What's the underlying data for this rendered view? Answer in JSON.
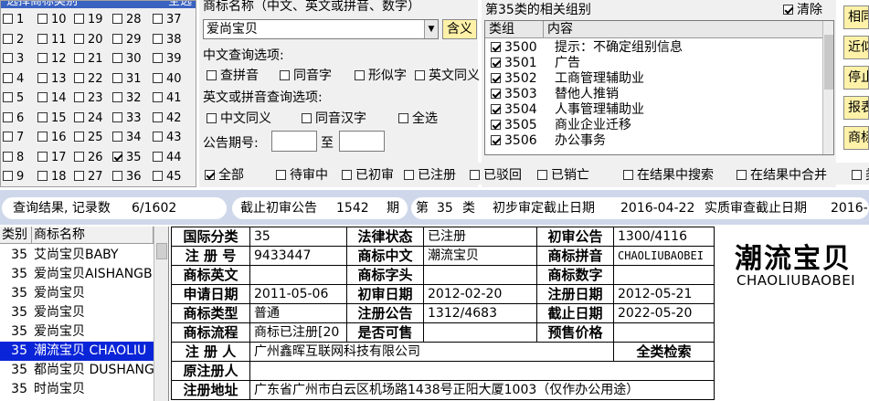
{
  "class_grid": {
    "title": "选择商标类别",
    "title_right": "全选",
    "columns": [
      [
        {
          "n": "1",
          "c": false
        },
        {
          "n": "2",
          "c": false
        },
        {
          "n": "3",
          "c": false
        },
        {
          "n": "4",
          "c": false
        },
        {
          "n": "5",
          "c": false
        },
        {
          "n": "6",
          "c": false
        },
        {
          "n": "7",
          "c": false
        },
        {
          "n": "8",
          "c": false
        },
        {
          "n": "9",
          "c": false
        }
      ],
      [
        {
          "n": "10",
          "c": false
        },
        {
          "n": "11",
          "c": false
        },
        {
          "n": "12",
          "c": false
        },
        {
          "n": "13",
          "c": false
        },
        {
          "n": "14",
          "c": false
        },
        {
          "n": "15",
          "c": false
        },
        {
          "n": "16",
          "c": false
        },
        {
          "n": "17",
          "c": false
        },
        {
          "n": "18",
          "c": false
        }
      ],
      [
        {
          "n": "19",
          "c": false
        },
        {
          "n": "20",
          "c": false
        },
        {
          "n": "21",
          "c": false
        },
        {
          "n": "22",
          "c": false
        },
        {
          "n": "23",
          "c": false
        },
        {
          "n": "24",
          "c": false
        },
        {
          "n": "25",
          "c": false
        },
        {
          "n": "26",
          "c": false
        },
        {
          "n": "27",
          "c": false
        }
      ],
      [
        {
          "n": "28",
          "c": false
        },
        {
          "n": "29",
          "c": false
        },
        {
          "n": "30",
          "c": false
        },
        {
          "n": "31",
          "c": false
        },
        {
          "n": "32",
          "c": false
        },
        {
          "n": "33",
          "c": false
        },
        {
          "n": "34",
          "c": false
        },
        {
          "n": "35",
          "c": true
        },
        {
          "n": "36",
          "c": false
        }
      ],
      [
        {
          "n": "37",
          "c": false
        },
        {
          "n": "38",
          "c": false
        },
        {
          "n": "39",
          "c": false
        },
        {
          "n": "40",
          "c": false
        },
        {
          "n": "41",
          "c": false
        },
        {
          "n": "42",
          "c": false
        },
        {
          "n": "43",
          "c": false
        },
        {
          "n": "44",
          "c": false
        },
        {
          "n": "45",
          "c": false
        }
      ]
    ]
  },
  "search": {
    "name_label": "商标名称（中文、英文或拼音、数字）",
    "name_value": "爱尚宝贝",
    "mean_button": "含义",
    "cn_options_label": "中文查询选项:",
    "cn_options": [
      {
        "label": "查拼音",
        "c": false
      },
      {
        "label": "同音字",
        "c": false
      },
      {
        "label": "形似字",
        "c": false
      },
      {
        "label": "英文同义",
        "c": false
      }
    ],
    "en_options_label": "英文或拼音查询选项:",
    "en_options": [
      {
        "label": "中文同义",
        "c": false
      },
      {
        "label": "同音汉字",
        "c": false
      },
      {
        "label": "全选",
        "c": false
      }
    ],
    "period_label": "公告期号:",
    "period_from": "",
    "period_to_label": "至",
    "period_to": ""
  },
  "group": {
    "title": "第35类的相关组别",
    "clear_label": "清除",
    "clear_checked": true,
    "col_group": "类组",
    "col_content": "内容",
    "rows": [
      {
        "code": "3500",
        "text": "提示：不确定组别信息",
        "c": true
      },
      {
        "code": "3501",
        "text": "广告",
        "c": true
      },
      {
        "code": "3502",
        "text": "工商管理辅助业",
        "c": true
      },
      {
        "code": "3503",
        "text": "替他人推销",
        "c": true
      },
      {
        "code": "3504",
        "text": "人事管理辅助业",
        "c": true
      },
      {
        "code": "3505",
        "text": "商业企业迁移",
        "c": true
      },
      {
        "code": "3506",
        "text": "办公事务",
        "c": true
      }
    ]
  },
  "side_buttons": [
    "相同",
    "近似",
    "停止",
    "报表",
    "商标"
  ],
  "filters": [
    {
      "label": "全部",
      "c": true
    },
    {
      "label": "待审中",
      "c": false
    },
    {
      "label": "已初审",
      "c": false
    },
    {
      "label": "已注册",
      "c": false
    },
    {
      "label": "已驳回",
      "c": false
    },
    {
      "label": "已销亡",
      "c": false
    },
    {
      "label": "在结果中搜索",
      "c": false
    },
    {
      "label": "在结果中合并",
      "c": false
    },
    {
      "label": "类",
      "c": false
    }
  ],
  "status": {
    "result_label": "查询结果, 记录数",
    "result_value": "6/1602",
    "cutoff_label": "截止初审公告",
    "cutoff_value": "1542",
    "cutoff_unit": "期",
    "class_prefix": "第",
    "class_value": "35",
    "class_suffix": "类",
    "prelim_label": "初步审定截止日期",
    "prelim_value": "2016-04-22",
    "exam_label": "实质审查截止日期",
    "exam_value": "2016-"
  },
  "results": {
    "col_class": "类别",
    "col_name": "商标名称",
    "rows": [
      {
        "cls": "35",
        "name": "艾尚宝贝BABY",
        "sel": false
      },
      {
        "cls": "35",
        "name": "爱尚宝贝AISHANGB",
        "sel": false
      },
      {
        "cls": "35",
        "name": "爱尚宝贝",
        "sel": false
      },
      {
        "cls": "35",
        "name": "爱尚宝贝",
        "sel": false
      },
      {
        "cls": "35",
        "name": "爱尚宝贝",
        "sel": false
      },
      {
        "cls": "35",
        "name": "潮流宝贝 CHAOLIU",
        "sel": true
      },
      {
        "cls": "35",
        "name": "都尚宝贝 DUSHANG",
        "sel": false
      },
      {
        "cls": "35",
        "name": "时尚宝贝",
        "sel": false
      }
    ]
  },
  "detail": {
    "intl_class_k": "国际分类",
    "intl_class_v": "35",
    "legal_k": "法律状态",
    "legal_v": "已注册",
    "prelim_notice_k": "初审公告",
    "prelim_notice_v": "1300/4116",
    "reg_no_k": "注 册 号",
    "reg_no_v": "9433447",
    "name_cn_k": "商标中文",
    "name_cn_v": "潮流宝贝",
    "pinyin_k": "商标拼音",
    "pinyin_v": "CHAOLIUBAOBEI",
    "name_en_k": "商标英文",
    "name_en_v": "",
    "initial_k": "商标字头",
    "initial_v": "",
    "digits_k": "商标数字",
    "digits_v": "",
    "apply_date_k": "申请日期",
    "apply_date_v": "2011-05-06",
    "prelim_date_k": "初审日期",
    "prelim_date_v": "2012-02-20",
    "reg_date_k": "注册日期",
    "reg_date_v": "2012-05-21",
    "type_k": "商标类型",
    "type_v": "普通",
    "reg_notice_k": "注册公告",
    "reg_notice_v": "1312/4683",
    "expiry_k": "截止日期",
    "expiry_v": "2022-05-20",
    "flow_k": "商标流程",
    "flow_v": "商标已注册[20",
    "sellable_k": "是否可售",
    "sellable_v": "",
    "price_k": "预售价格",
    "price_v": "",
    "registrant_k": "注 册 人",
    "registrant_v": "广州鑫晖互联网科技有限公司",
    "full_search": "全类检索",
    "orig_registrant_k": "原注册人",
    "orig_registrant_v": "",
    "address_k": "注册地址",
    "address_v": "广东省广州市白云区机场路1438号正阳大厦1003（仅作办公用途）"
  },
  "logo": {
    "cn": "潮流宝贝",
    "en": "CHAOLIUBAOBEI"
  }
}
